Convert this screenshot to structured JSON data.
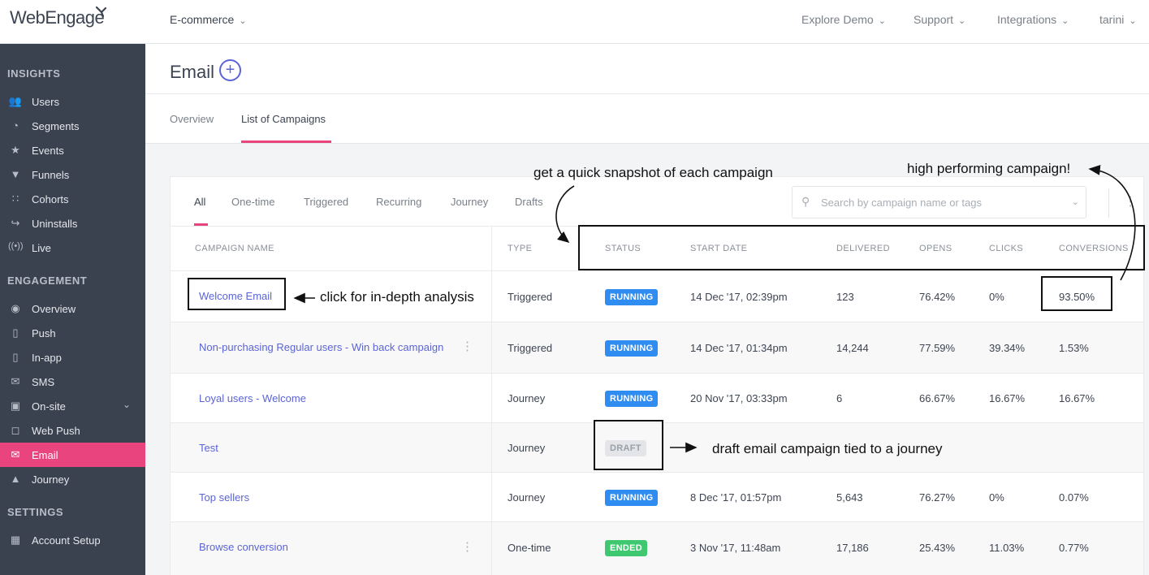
{
  "topbar": {
    "logo": "WebEngage",
    "workspace": "E-commerce",
    "nav": [
      "Explore Demo",
      "Support",
      "Integrations",
      "tarini"
    ]
  },
  "sidebar": {
    "sections": [
      "INSIGHTS",
      "ENGAGEMENT",
      "SETTINGS"
    ],
    "insights": [
      {
        "label": "Users",
        "icon": "users-icon"
      },
      {
        "label": "Segments",
        "icon": "pie-chart-icon"
      },
      {
        "label": "Events",
        "icon": "star-icon"
      },
      {
        "label": "Funnels",
        "icon": "funnel-icon"
      },
      {
        "label": "Cohorts",
        "icon": "grid-icon"
      },
      {
        "label": "Uninstalls",
        "icon": "exit-icon"
      },
      {
        "label": "Live",
        "icon": "broadcast-icon"
      }
    ],
    "engagement": [
      {
        "label": "Overview",
        "icon": "eye-icon"
      },
      {
        "label": "Push",
        "icon": "mobile-icon"
      },
      {
        "label": "In-app",
        "icon": "tablet-icon"
      },
      {
        "label": "SMS",
        "icon": "chat-icon"
      },
      {
        "label": "On-site",
        "icon": "window-icon"
      },
      {
        "label": "Web Push",
        "icon": "browser-icon"
      },
      {
        "label": "Email",
        "icon": "envelope-icon"
      },
      {
        "label": "Journey",
        "icon": "rocket-icon"
      }
    ],
    "settings": [
      {
        "label": "Account Setup",
        "icon": "apps-icon"
      }
    ],
    "active": "Email",
    "active_color": "#e9447d"
  },
  "page": {
    "title": "Email",
    "tabs": [
      "Overview",
      "List of Campaigns"
    ],
    "active_tab": "List of Campaigns"
  },
  "filters": {
    "tabs": [
      "All",
      "One-time",
      "Triggered",
      "Recurring",
      "Journey",
      "Drafts"
    ],
    "active": "All",
    "search_placeholder": "Search by campaign name or tags"
  },
  "table": {
    "headers": [
      "CAMPAIGN NAME",
      "TYPE",
      "STATUS",
      "START DATE",
      "DELIVERED",
      "OPENS",
      "CLICKS",
      "CONVERSIONS"
    ],
    "rows": [
      {
        "name": "Welcome Email",
        "type": "Triggered",
        "status": "RUNNING",
        "start": "14 Dec '17, 02:39pm",
        "delivered": "123",
        "opens": "76.42%",
        "clicks": "0%",
        "conversions": "93.50%"
      },
      {
        "name": "Non-purchasing Regular users - Win back campaign",
        "type": "Triggered",
        "status": "RUNNING",
        "start": "14 Dec '17, 01:34pm",
        "delivered": "14,244",
        "opens": "77.59%",
        "clicks": "39.34%",
        "conversions": "1.53%"
      },
      {
        "name": "Loyal users - Welcome",
        "type": "Journey",
        "status": "RUNNING",
        "start": "20 Nov '17, 03:33pm",
        "delivered": "6",
        "opens": "66.67%",
        "clicks": "16.67%",
        "conversions": "16.67%"
      },
      {
        "name": "Test",
        "type": "Journey",
        "status": "DRAFT",
        "start": "",
        "delivered": "",
        "opens": "",
        "clicks": "",
        "conversions": ""
      },
      {
        "name": "Top sellers",
        "type": "Journey",
        "status": "RUNNING",
        "start": "8 Dec '17, 01:57pm",
        "delivered": "5,643",
        "opens": "76.27%",
        "clicks": "0%",
        "conversions": "0.07%"
      },
      {
        "name": "Browse conversion",
        "type": "One-time",
        "status": "ENDED",
        "start": "3 Nov '17, 11:48am",
        "delivered": "17,186",
        "opens": "25.43%",
        "clicks": "11.03%",
        "conversions": "0.77%"
      }
    ]
  },
  "annotations": {
    "snapshot": "get a quick snapshot of each campaign",
    "high_performing": "high performing campaign!",
    "click_analysis": "click for in-depth analysis",
    "draft": "draft email campaign tied to a journey"
  }
}
